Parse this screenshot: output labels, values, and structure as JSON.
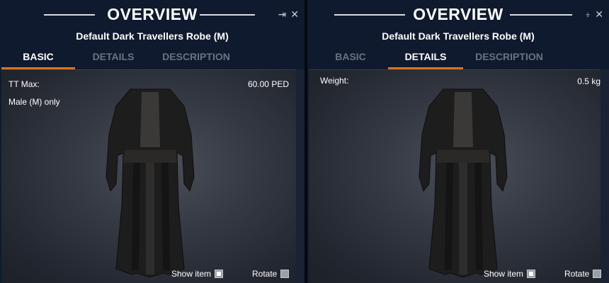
{
  "left_panel": {
    "title": "OVERVIEW",
    "subtitle": "Default Dark Travellers Robe (M)",
    "icons": {
      "pin": "pin-icon",
      "close": "close-icon"
    },
    "pin_glyph": "⇥",
    "close_glyph": "✕",
    "tabs": [
      {
        "label": "BASIC",
        "active": true
      },
      {
        "label": "DETAILS",
        "active": false
      },
      {
        "label": "DESCRIPTION",
        "active": false
      }
    ],
    "tt_max_label": "TT Max:",
    "tt_max_value": "60.00 PED",
    "gender_note": "Male (M) only",
    "show_item_label": "Show item",
    "show_item_checked": true,
    "rotate_label": "Rotate",
    "rotate_checked": false
  },
  "right_panel": {
    "title": "OVERVIEW",
    "subtitle": "Default Dark Travellers Robe (M)",
    "icons": {
      "pin": "pin-icon",
      "close": "close-icon"
    },
    "pin_glyph": "⍖",
    "close_glyph": "✕",
    "tabs": [
      {
        "label": "BASIC",
        "active": false
      },
      {
        "label": "DETAILS",
        "active": true
      },
      {
        "label": "DESCRIPTION",
        "active": false
      }
    ],
    "weight_label": "Weight:",
    "weight_value": "0.5 kg",
    "show_item_label": "Show item",
    "show_item_checked": true,
    "rotate_label": "Rotate",
    "rotate_checked": false
  },
  "colors": {
    "accent_tab_underline": "#d9731f",
    "panel_bg": "#0f1a2e",
    "inactive_tab": "#6a7384"
  }
}
